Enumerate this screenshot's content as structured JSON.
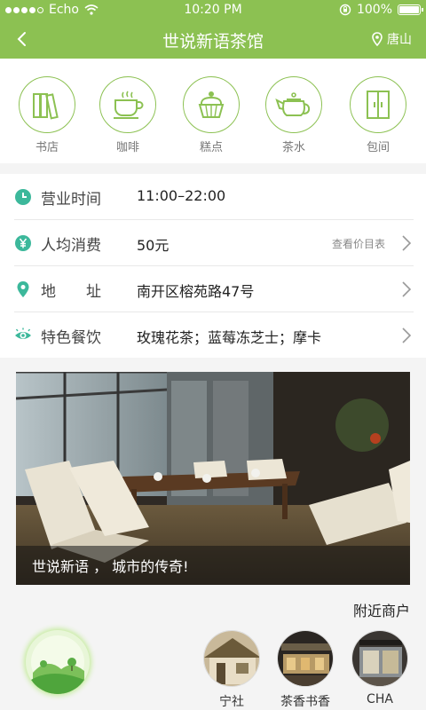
{
  "status_bar": {
    "carrier": "Echo",
    "time": "10:20 PM",
    "battery": "100%"
  },
  "nav": {
    "title": "世说新语茶馆",
    "location": "唐山",
    "colors": {
      "brand": "#8cc152"
    }
  },
  "categories": [
    {
      "label": "书店",
      "icon": "books-icon"
    },
    {
      "label": "咖啡",
      "icon": "coffee-cup-icon"
    },
    {
      "label": "糕点",
      "icon": "cupcake-icon"
    },
    {
      "label": "茶水",
      "icon": "teapot-icon"
    },
    {
      "label": "包间",
      "icon": "private-room-door-icon"
    }
  ],
  "info": {
    "hours": {
      "label": "营业时间",
      "value": "11:00–22:00"
    },
    "price": {
      "label": "人均消费",
      "value": "50元",
      "link": "查看价目表"
    },
    "address": {
      "label": "地　　址",
      "value": "南开区榕苑路47号"
    },
    "specialty": {
      "label": "特色餐饮",
      "value": "玫瑰花茶；蓝莓冻芝士；摩卡"
    }
  },
  "banner": {
    "caption": "世说新语 ， 城市的传奇!"
  },
  "nearby": {
    "title": "附近商户",
    "shops": [
      {
        "name": "宁社"
      },
      {
        "name": "茶香书香"
      },
      {
        "name": "CHA"
      }
    ]
  }
}
